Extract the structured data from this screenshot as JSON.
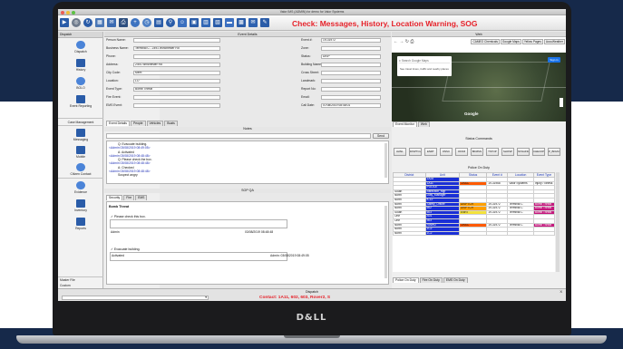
{
  "window": {
    "title": "Valor IMS (ADMIN) for demo for Valor Systems"
  },
  "toolbar": {
    "alert": "Check: Messages, History, Location Warning, SOG",
    "icons": [
      "dispatch-icon",
      "globe-icon",
      "refresh-icon",
      "grid-icon",
      "mail-icon",
      "print-icon",
      "plus-icon",
      "clock-icon",
      "map-icon",
      "pin-icon",
      "person-icon",
      "image-icon",
      "calendar-icon",
      "contact-icon",
      "truck-icon",
      "building-icon",
      "mail-icon",
      "message-icon"
    ],
    "colors": {
      "alert": "#e6222a",
      "accent": "#2a5ca8"
    }
  },
  "sidebar": {
    "header": "Dispatch",
    "groups": [
      {
        "label": "Dispatch"
      },
      {
        "label": "History"
      },
      {
        "label": "BOLO"
      },
      {
        "label": "Event Reporting"
      },
      {
        "label": "Case Management"
      },
      {
        "label": "Messaging"
      },
      {
        "label": "Mobile"
      },
      {
        "label": "Citizen Contact"
      },
      {
        "label": "Evidence"
      },
      {
        "label": "Inventory"
      },
      {
        "label": "Reports"
      }
    ],
    "bottom": [
      "Master File",
      "Custom"
    ]
  },
  "event_details": {
    "header": "Event Details",
    "left_fields": [
      {
        "label": "Person Name:",
        "value": ""
      },
      {
        "label": "Business Name:",
        "value": "Terminal C - 2491 Winchester Rd"
      },
      {
        "label": "Phone:",
        "value": ""
      },
      {
        "label": "Address:",
        "value": "2491 Winchester Rd"
      },
      {
        "label": "City Code:",
        "value": "Mem"
      },
      {
        "label": "Location:",
        "value": "LO"
      },
      {
        "label": "Event Type:",
        "value": "Bomb Threat"
      },
      {
        "label": "Fire Event:",
        "value": ""
      },
      {
        "label": "EMS Event:",
        "value": ""
      }
    ],
    "right_fields": [
      {
        "label": "Event #:",
        "value": "19-31972"
      },
      {
        "label": "Zone:",
        "value": ""
      },
      {
        "label": "Status:",
        "value": "DISP"
      },
      {
        "label": "Building Name:",
        "value": ""
      },
      {
        "label": "Cross Street:",
        "value": ""
      },
      {
        "label": "Landmark:",
        "value": ""
      },
      {
        "label": "Report No:",
        "value": ""
      },
      {
        "label": "Email:",
        "value": ""
      },
      {
        "label": "Call Date:",
        "value": "07/08/2019 08:48:01"
      }
    ],
    "tabs": [
      "Event Details",
      "People",
      "Vehicles",
      "Boats"
    ]
  },
  "notes": {
    "header": "Notes",
    "send_label": "Send",
    "lines": [
      {
        "text": "Q: Evacuate building.",
        "style": "q"
      },
      {
        "text": "<Admin 03/08/2019 08:49:05>",
        "style": "b"
      },
      {
        "text": "A: Activated",
        "style": "a"
      },
      {
        "text": "<Admin 03/08/2019 08:48:48>",
        "style": "b"
      },
      {
        "text": "Q: Please check the box.",
        "style": "q"
      },
      {
        "text": "<Admin 03/08/2019 08:48:48>",
        "style": "b"
      },
      {
        "text": "A: Checked",
        "style": "a"
      },
      {
        "text": "<Admin 03/08/2019 08:48:48>",
        "style": "b"
      },
      {
        "text": "Suspect angry",
        "style": "a"
      }
    ]
  },
  "sop": {
    "header": "SOP QA",
    "tabs": [
      "Security",
      "Fire",
      "EMS"
    ],
    "title": "Bomb Threat",
    "q1": "Please check this box.",
    "q1_admin": "Admin",
    "q1_date": "03/08/2019 08:48:48",
    "q2": "Evacuate building.",
    "q2_answer": "Activated",
    "q2_admin": "Admin: 03/08/2019 08:49:05"
  },
  "web": {
    "header": "Web",
    "links": [
      "CAMEO Chemicals",
      "Google Maps",
      "Yellow Pages",
      "AccuWeather"
    ],
    "search_placeholder": "Search Google Maps",
    "hint": "See travel times, traffic and nearby places",
    "sign_in": "Sign in",
    "map_label": "Google"
  },
  "event_monitor": {
    "tabs": [
      "Event Monitor",
      "Web"
    ],
    "status_header": "Status Commands",
    "status_buttons": [
      "AVAIL",
      "DISPTCH",
      "ENRT",
      "ONSC",
      "OFFM",
      "BKMSN",
      "TSTOP",
      "SHOSP",
      "STAGING",
      "CHECKPOINT",
      "P_BKMU"
    ],
    "pod_header": "Police On Duty",
    "columns": [
      "District",
      "Unit",
      "Status",
      "Event #",
      "Location",
      "Event Type"
    ],
    "rows": [
      {
        "district": "",
        "unit": "1A28",
        "status": "",
        "event": "",
        "location": "",
        "type": "",
        "sc": ""
      },
      {
        "district": "",
        "unit": "1A11",
        "status": "ONSC",
        "event": "19-31968",
        "location": "Valor Systems",
        "type": "Injury / Illness",
        "sc": "#ff5a00"
      },
      {
        "district": "",
        "unit": "POLICE",
        "status": "",
        "event": "",
        "location": "",
        "type": "",
        "sc": ""
      },
      {
        "district": "South",
        "unit": "Attraction_Mgr",
        "status": "",
        "event": "",
        "location": "",
        "type": "",
        "sc": ""
      },
      {
        "district": "North",
        "unit": "Duty_Manager",
        "status": "",
        "event": "",
        "location": "",
        "type": "",
        "sc": ""
      },
      {
        "district": "North",
        "unit": "K-12",
        "status": "",
        "event": "",
        "location": "",
        "type": "",
        "sc": ""
      },
      {
        "district": "North",
        "unit": "Safety_Officer",
        "status": "DISPTCH",
        "event": "19-31972",
        "location": "Terminal C",
        "type": "Bomb Threat",
        "sc": "#ffa000"
      },
      {
        "district": "North",
        "unit": "602",
        "status": "DISPTCH",
        "event": "19-31972",
        "location": "Terminal C",
        "type": "Bomb Threat",
        "sc": "#ffa000"
      },
      {
        "district": "South",
        "unit": "603",
        "status": "ENRT",
        "event": "19-31972",
        "location": "Terminal C",
        "type": "Bomb Threat",
        "sc": "#f4e23a"
      },
      {
        "district": "One",
        "unit": "A01",
        "status": "",
        "event": "",
        "location": "",
        "type": "",
        "sc": ""
      },
      {
        "district": "One",
        "unit": "303",
        "status": "",
        "event": "",
        "location": "",
        "type": "",
        "sc": ""
      },
      {
        "district": "North",
        "unit": "Rover2",
        "status": "ONSC",
        "event": "19-31972",
        "location": "Terminal C",
        "type": "Bomb Threat",
        "sc": "#ff5a00"
      },
      {
        "district": "North",
        "unit": "1C2",
        "status": "",
        "event": "",
        "location": "",
        "type": "",
        "sc": ""
      },
      {
        "district": "North",
        "unit": "1C2",
        "status": "",
        "event": "",
        "location": "",
        "type": "",
        "sc": ""
      }
    ],
    "bottom_tabs": [
      "Police On Duty",
      "Fire On Duty",
      "EMS On Duty"
    ]
  },
  "footer": {
    "title": "Dispatch",
    "contact": "Contact: 1A11, 602, 603, Rover2, S",
    "close": "X"
  },
  "device": {
    "brand": "D&LL"
  }
}
